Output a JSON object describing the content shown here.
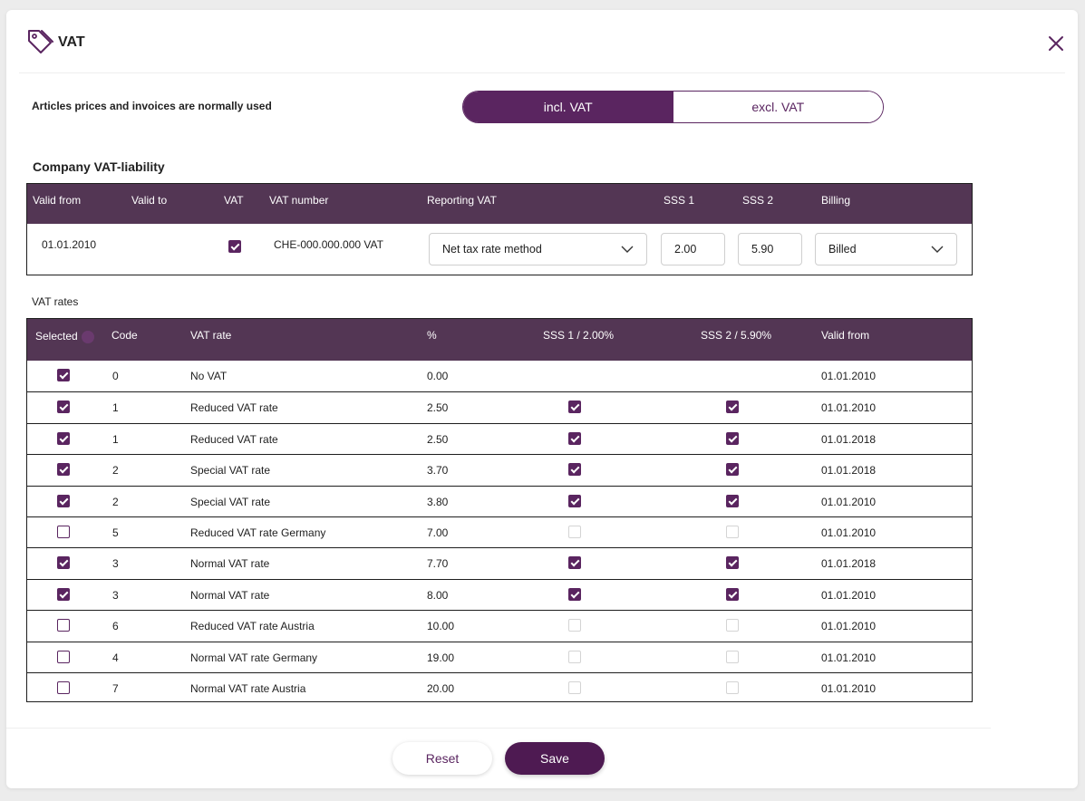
{
  "dialog": {
    "title": "VAT",
    "tag_icon": "tag-icon",
    "close_icon": "close-icon"
  },
  "pricing_mode": {
    "label": "Articles prices and invoices are normally used",
    "options": [
      "incl. VAT",
      "excl. VAT"
    ],
    "selected": "incl. VAT"
  },
  "company": {
    "title": "Company VAT-liability",
    "headers": {
      "valid_from": "Valid from",
      "valid_to": "Valid to",
      "vat": "VAT",
      "vat_number": "VAT number",
      "reporting": "Reporting VAT",
      "sss1": "SSS 1",
      "sss2": "SSS 2",
      "billing": "Billing"
    },
    "row": {
      "valid_from": "01.01.2010",
      "valid_to": "",
      "vat_checked": true,
      "vat_number": "CHE-000.000.000 VAT",
      "reporting": "Net tax rate method",
      "sss1": "2.00",
      "sss2": "5.90",
      "billing": "Billed"
    }
  },
  "rates": {
    "label": "VAT rates",
    "headers": {
      "selected": "Selected",
      "code": "Code",
      "rate": "VAT rate",
      "pct": "%",
      "sss1": "SSS 1 / 2.00%",
      "sss2": "SSS 2 / 5.90%",
      "valid_from": "Valid from"
    },
    "rows": [
      {
        "selected": true,
        "code": "0",
        "name": "No VAT",
        "pct": "0.00",
        "sss1": null,
        "sss2": null,
        "valid_from": "01.01.2010"
      },
      {
        "selected": true,
        "code": "1",
        "name": "Reduced VAT rate",
        "pct": "2.50",
        "sss1": true,
        "sss2": true,
        "valid_from": "01.01.2010"
      },
      {
        "selected": true,
        "code": "1",
        "name": "Reduced VAT rate",
        "pct": "2.50",
        "sss1": true,
        "sss2": true,
        "valid_from": "01.01.2018"
      },
      {
        "selected": true,
        "code": "2",
        "name": "Special VAT rate",
        "pct": "3.70",
        "sss1": true,
        "sss2": true,
        "valid_from": "01.01.2018"
      },
      {
        "selected": true,
        "code": "2",
        "name": "Special VAT rate",
        "pct": "3.80",
        "sss1": true,
        "sss2": true,
        "valid_from": "01.01.2010"
      },
      {
        "selected": false,
        "code": "5",
        "name": "Reduced VAT rate Germany",
        "pct": "7.00",
        "sss1": false,
        "sss2": false,
        "valid_from": "01.01.2010"
      },
      {
        "selected": true,
        "code": "3",
        "name": "Normal VAT rate",
        "pct": "7.70",
        "sss1": true,
        "sss2": true,
        "valid_from": "01.01.2018"
      },
      {
        "selected": true,
        "code": "3",
        "name": "Normal VAT rate",
        "pct": "8.00",
        "sss1": true,
        "sss2": true,
        "valid_from": "01.01.2010"
      },
      {
        "selected": false,
        "code": "6",
        "name": "Reduced VAT rate Austria",
        "pct": "10.00",
        "sss1": false,
        "sss2": false,
        "valid_from": "01.01.2010"
      },
      {
        "selected": false,
        "code": "4",
        "name": "Normal VAT rate Germany",
        "pct": "19.00",
        "sss1": false,
        "sss2": false,
        "valid_from": "01.01.2010"
      },
      {
        "selected": false,
        "code": "7",
        "name": "Normal VAT rate Austria",
        "pct": "20.00",
        "sss1": false,
        "sss2": false,
        "valid_from": "01.01.2010"
      }
    ]
  },
  "footer": {
    "reset_label": "Reset",
    "save_label": "Save"
  },
  "colors": {
    "accent": "#5a2560",
    "table_header": "#533654"
  }
}
